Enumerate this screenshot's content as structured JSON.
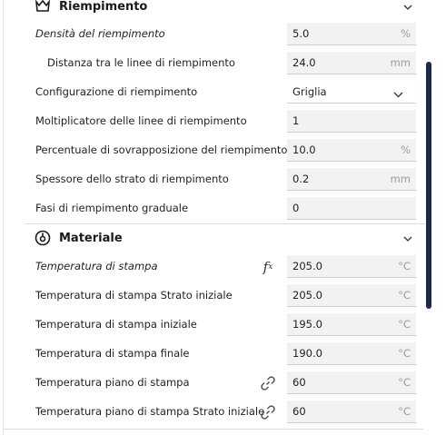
{
  "infill": {
    "title": "Riempimento",
    "rows": [
      {
        "label": "Densità del riempimento",
        "value": "5.0",
        "unit": "%"
      },
      {
        "label": "Distanza tra le linee di riempimento",
        "value": "24.0",
        "unit": "mm"
      },
      {
        "label": "Configurazione di riempimento",
        "value": "Griglia"
      },
      {
        "label": "Moltiplicatore delle linee di riempimento",
        "value": "1"
      },
      {
        "label": "Percentuale di sovrapposizione del riempimento",
        "value": "10.0",
        "unit": "%"
      },
      {
        "label": "Spessore dello strato di riempimento",
        "value": "0.2",
        "unit": "mm"
      },
      {
        "label": "Fasi di riempimento graduale",
        "value": "0"
      }
    ]
  },
  "material": {
    "title": "Materiale",
    "rows": [
      {
        "label": "Temperatura di stampa",
        "value": "205.0",
        "unit": "°C"
      },
      {
        "label": "Temperatura di stampa Strato iniziale",
        "value": "205.0",
        "unit": "°C"
      },
      {
        "label": "Temperatura di stampa iniziale",
        "value": "195.0",
        "unit": "°C"
      },
      {
        "label": "Temperatura di stampa finale",
        "value": "190.0",
        "unit": "°C"
      },
      {
        "label": "Temperatura piano di stampa",
        "value": "60",
        "unit": "°C"
      },
      {
        "label": "Temperatura piano di stampa Strato iniziale",
        "value": "60",
        "unit": "°C"
      }
    ]
  }
}
